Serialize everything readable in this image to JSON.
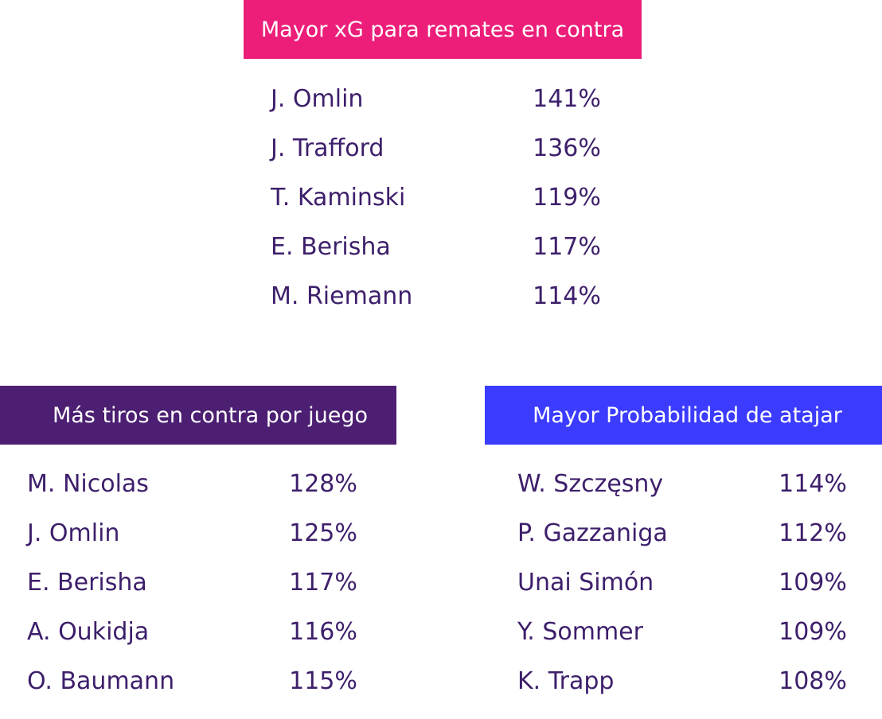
{
  "top_section": {
    "title": "Mayor xG para remates en contra",
    "rows": [
      {
        "name": "J. Omlin",
        "value": "141%"
      },
      {
        "name": "J. Trafford",
        "value": "136%"
      },
      {
        "name": "T. Kaminski",
        "value": "119%"
      },
      {
        "name": "E. Berisha",
        "value": "117%"
      },
      {
        "name": "M. Riemann",
        "value": "114%"
      }
    ]
  },
  "left_section": {
    "title": "Más tiros en contra por juego",
    "rows": [
      {
        "name": "M. Nicolas",
        "value": "128%"
      },
      {
        "name": "J. Omlin",
        "value": "125%"
      },
      {
        "name": "E. Berisha",
        "value": "117%"
      },
      {
        "name": "A. Oukidja",
        "value": "116%"
      },
      {
        "name": "O. Baumann",
        "value": "115%"
      }
    ]
  },
  "right_section": {
    "title": "Mayor Probabilidad de atajar",
    "rows": [
      {
        "name": "W. Szczęsny",
        "value": "114%"
      },
      {
        "name": "P. Gazzaniga",
        "value": "112%"
      },
      {
        "name": "Unai Simón",
        "value": "109%"
      },
      {
        "name": "Y. Sommer",
        "value": "109%"
      },
      {
        "name": "K. Trapp",
        "value": "108%"
      }
    ]
  },
  "colors": {
    "top_header": "#ec1e79",
    "left_header": "#4c1f72",
    "right_header": "#3b3cff",
    "text": "#3d1f6b"
  }
}
